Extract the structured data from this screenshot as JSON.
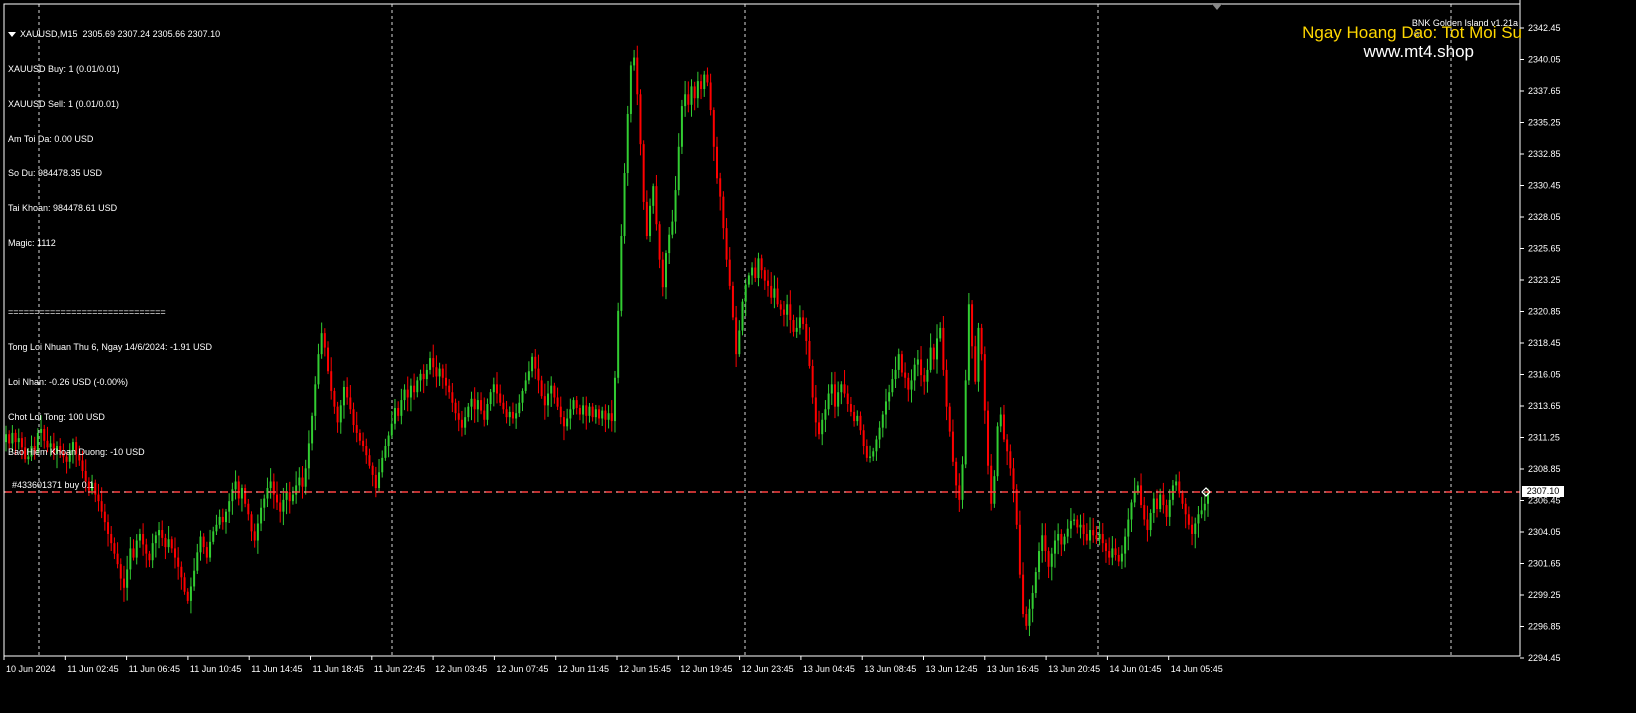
{
  "header": {
    "symbol_line": "XAUUSD,M15  2305.69 2307.24 2305.66 2307.10"
  },
  "info_panel": {
    "lines": [
      "XAUUSD Buy: 1 (0.01/0.01)",
      "XAUUSD Sell: 1 (0.01/0.01)",
      "Am Toi Da: 0.00 USD",
      "So Du: 984478.35 USD",
      "Tai Khoan: 984478.61 USD",
      "Magic: 1112",
      "",
      "==============================",
      "Tong Loi Nhuan Thu 6, Ngay 14/6/2024: -1.91 USD",
      "Loi Nhan: -0.26 USD (-0.00%)",
      "Chot Loi Tong: 100 USD",
      "Bao Hiem Khoan Duong: -10 USD"
    ]
  },
  "ea": {
    "name": "BNK Golden Island v1.21a",
    "icon": "smiley-icon"
  },
  "slogan": "Ngay Hoang Dao: Tot Moi Su",
  "website": "www.mt4.shop",
  "order_tag": "#433601371 buy 0.1",
  "current_price_label": "2307.10",
  "colors": {
    "background": "#000000",
    "bull": "#32cd32",
    "bear": "#ff0000",
    "grid": "#ffffff",
    "price_line": "#c0c0c0",
    "order_line": "#ff4040",
    "slogan": "#ffd700"
  },
  "chart_data": {
    "type": "candlestick",
    "timeframe": "M15",
    "y_ticks": [
      "2342.45",
      "2340.05",
      "2337.65",
      "2335.25",
      "2332.85",
      "2330.45",
      "2328.05",
      "2325.65",
      "2323.25",
      "2320.85",
      "2318.45",
      "2316.05",
      "2313.65",
      "2311.25",
      "2308.85",
      "2306.45",
      "2304.05",
      "2301.65",
      "2299.25",
      "2296.85",
      "2294.45"
    ],
    "ylim": [
      2294.45,
      2342.45
    ],
    "x_ticks": [
      "10 Jun 2024",
      "11 Jun 02:45",
      "11 Jun 06:45",
      "11 Jun 10:45",
      "11 Jun 14:45",
      "11 Jun 18:45",
      "11 Jun 22:45",
      "12 Jun 03:45",
      "12 Jun 07:45",
      "12 Jun 11:45",
      "12 Jun 15:45",
      "12 Jun 19:45",
      "12 Jun 23:45",
      "13 Jun 04:45",
      "13 Jun 08:45",
      "13 Jun 12:45",
      "13 Jun 16:45",
      "13 Jun 20:45",
      "14 Jun 01:45",
      "14 Jun 05:45"
    ],
    "last_price": 2307.1,
    "order_price": 2307.1,
    "path_closes": [
      2311.5,
      2310.8,
      2311.6,
      2310.9,
      2311.2,
      2310.5,
      2309.6,
      2309.8,
      2310.6,
      2310.2,
      2311.6,
      2311.9,
      2311.0,
      2310.5,
      2310.8,
      2310.0,
      2310.6,
      2310.1,
      2309.8,
      2309.4,
      2310.3,
      2310.9,
      2310.0,
      2309.5,
      2308.7,
      2307.9,
      2307.2,
      2307.8,
      2306.9,
      2306.4,
      2305.6,
      2304.8,
      2303.9,
      2303.2,
      2302.4,
      2301.6,
      2300.5,
      2299.8,
      2301.2,
      2302.8,
      2302.1,
      2303.4,
      2303.9,
      2303.1,
      2302.4,
      2301.9,
      2303.2,
      2303.8,
      2304.2,
      2303.6,
      2302.9,
      2303.5,
      2302.8,
      2302.1,
      2301.4,
      2300.6,
      2299.5,
      2298.8,
      2299.9,
      2301.1,
      2302.5,
      2303.7,
      2302.9,
      2302.1,
      2303.3,
      2304.1,
      2304.6,
      2305.2,
      2304.8,
      2305.6,
      2306.4,
      2307.3,
      2307.9,
      2306.6,
      2307.4,
      2306.2,
      2305.4,
      2304.1,
      2303.4,
      2304.7,
      2305.9,
      2306.6,
      2307.4,
      2307.9,
      2306.9,
      2306.3,
      2305.6,
      2306.5,
      2307.1,
      2306.4,
      2306.9,
      2307.6,
      2308.2,
      2307.5,
      2308.9,
      2310.8,
      2312.9,
      2315.3,
      2317.6,
      2319.2,
      2318.1,
      2316.3,
      2314.8,
      2313.6,
      2312.4,
      2313.7,
      2315.1,
      2314.3,
      2313.4,
      2312.2,
      2311.6,
      2311.0,
      2310.6,
      2309.9,
      2309.1,
      2308.4,
      2307.4,
      2308.6,
      2309.7,
      2310.6,
      2311.4,
      2312.3,
      2313.5,
      2312.9,
      2314.1,
      2314.9,
      2314.3,
      2315.2,
      2314.7,
      2315.6,
      2316.1,
      2315.7,
      2316.4,
      2317.3,
      2316.6,
      2315.9,
      2316.5,
      2315.8,
      2315.2,
      2314.7,
      2313.9,
      2313.1,
      2312.6,
      2312.0,
      2312.8,
      2313.6,
      2314.2,
      2313.4,
      2314.1,
      2313.3,
      2312.6,
      2313.8,
      2314.7,
      2315.3,
      2314.6,
      2313.9,
      2313.4,
      2312.8,
      2313.2,
      2312.7,
      2313.1,
      2313.9,
      2314.8,
      2315.6,
      2316.3,
      2317.4,
      2316.5,
      2315.6,
      2314.4,
      2313.7,
      2314.6,
      2315.2,
      2314.3,
      2313.6,
      2312.8,
      2312.1,
      2312.7,
      2313.4,
      2314.1,
      2313.5,
      2313.0,
      2313.7,
      2312.9,
      2313.6,
      2312.8,
      2313.4,
      2312.7,
      2313.3,
      2312.6,
      2313.1,
      2312.5,
      2315.8,
      2320.9,
      2326.6,
      2331.4,
      2335.9,
      2339.6,
      2340.2,
      2337.4,
      2333.6,
      2329.2,
      2326.6,
      2328.9,
      2330.4,
      2327.5,
      2324.8,
      2322.7,
      2325.3,
      2326.7,
      2327.7,
      2330.1,
      2333.4,
      2336.5,
      2337.4,
      2336.6,
      2338.0,
      2337.1,
      2338.4,
      2337.8,
      2338.9,
      2338.3,
      2336.2,
      2333.4,
      2331.0,
      2329.6,
      2327.2,
      2324.8,
      2322.8,
      2320.4,
      2317.6,
      2319.4,
      2321.6,
      2322.9,
      2323.6,
      2324.2,
      2323.4,
      2324.9,
      2324.0,
      2323.2,
      2322.8,
      2321.9,
      2322.6,
      2321.4,
      2321.0,
      2320.6,
      2321.4,
      2320.2,
      2319.3,
      2319.6,
      2320.4,
      2319.9,
      2318.6,
      2316.7,
      2314.3,
      2312.4,
      2311.5,
      2312.6,
      2313.4,
      2314.6,
      2315.3,
      2313.6,
      2314.7,
      2315.3,
      2314.6,
      2313.8,
      2313.2,
      2312.5,
      2312.9,
      2311.8,
      2310.6,
      2309.7,
      2309.8,
      2310.2,
      2311.1,
      2312.0,
      2313.0,
      2314.0,
      2314.7,
      2315.7,
      2316.4,
      2317.6,
      2316.2,
      2315.8,
      2314.9,
      2315.6,
      2316.8,
      2317.2,
      2316.0,
      2315.5,
      2316.4,
      2318.1,
      2317.2,
      2318.8,
      2319.6,
      2316.4,
      2313.6,
      2311.7,
      2309.4,
      2307.6,
      2306.5,
      2309.2,
      2315.6,
      2321.4,
      2318.2,
      2315.5,
      2319.6,
      2317.6,
      2313.3,
      2309.1,
      2306.2,
      2308.3,
      2312.1,
      2313.0,
      2311.1,
      2310.2,
      2308.9,
      2307.3,
      2304.6,
      2300.8,
      2297.8,
      2296.9,
      2298.2,
      2299.4,
      2301.0,
      2302.6,
      2303.8,
      2302.6,
      2301.4,
      2302.4,
      2303.4,
      2303.9,
      2303.1,
      2303.7,
      2304.3,
      2304.9,
      2305.0,
      2304.4,
      2304.6,
      2303.9,
      2303.4,
      2304.2,
      2303.8,
      2303.5,
      2303.9,
      2303.2,
      2302.6,
      2302.1,
      2302.8,
      2302.3,
      2301.8,
      2302.4,
      2303.7,
      2305.0,
      2306.3,
      2307.1,
      2307.6,
      2306.1,
      2305.0,
      2304.2,
      2305.5,
      2306.6,
      2305.8,
      2306.9,
      2306.1,
      2305.2,
      2306.5,
      2307.6,
      2307.9,
      2307.0,
      2306.2,
      2305.4,
      2304.6,
      2303.9,
      2304.7,
      2305.4,
      2305.7,
      2306.2,
      2307.1
    ]
  }
}
